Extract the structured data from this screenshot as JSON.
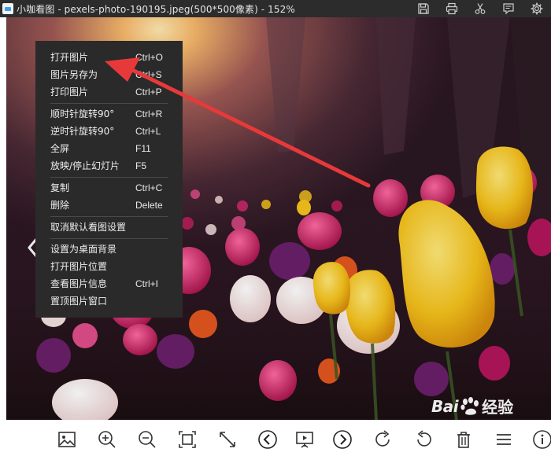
{
  "window": {
    "title": "小咖看图 - pexels-photo-190195.jpeg(500*500像素) - 152%"
  },
  "title_actions": [
    {
      "icon": "save-icon"
    },
    {
      "icon": "print-icon"
    },
    {
      "icon": "scissors-icon"
    },
    {
      "icon": "comment-icon"
    },
    {
      "icon": "gear-icon"
    }
  ],
  "context_menu": {
    "groups": [
      [
        {
          "label": "打开图片",
          "shortcut": "Ctrl+O"
        },
        {
          "label": "图片另存为",
          "shortcut": "Ctrl+S"
        },
        {
          "label": "打印图片",
          "shortcut": "Ctrl+P"
        }
      ],
      [
        {
          "label": "顺时针旋转90°",
          "shortcut": "Ctrl+R"
        },
        {
          "label": "逆时针旋转90°",
          "shortcut": "Ctrl+L"
        },
        {
          "label": "全屏",
          "shortcut": "F11"
        },
        {
          "label": "放映/停止幻灯片",
          "shortcut": "F5"
        }
      ],
      [
        {
          "label": "复制",
          "shortcut": "Ctrl+C"
        },
        {
          "label": "删除",
          "shortcut": "Delete"
        }
      ],
      [
        {
          "label": "取消默认看图设置",
          "shortcut": ""
        }
      ],
      [
        {
          "label": "设置为桌面背景",
          "shortcut": ""
        },
        {
          "label": "打开图片位置",
          "shortcut": ""
        },
        {
          "label": "查看图片信息",
          "shortcut": "Ctrl+I"
        },
        {
          "label": "置顶图片窗口",
          "shortcut": ""
        }
      ]
    ]
  },
  "toolbar": {
    "buttons": [
      {
        "icon": "picture-icon"
      },
      {
        "icon": "zoom-in-icon"
      },
      {
        "icon": "zoom-out-icon"
      },
      {
        "icon": "actual-size-icon"
      },
      {
        "icon": "fit-screen-icon"
      },
      {
        "icon": "previous-icon"
      },
      {
        "icon": "slideshow-icon"
      },
      {
        "icon": "next-icon"
      },
      {
        "icon": "rotate-clockwise-icon"
      },
      {
        "icon": "rotate-counterclockwise-icon"
      },
      {
        "icon": "delete-icon"
      },
      {
        "icon": "menu-icon"
      },
      {
        "icon": "info-icon"
      }
    ]
  },
  "watermark": {
    "brand_latin": "Bai",
    "brand_cn": "经验"
  },
  "colors": {
    "titlebar_bg": "#2c2c2c",
    "menu_bg": "#2a2a2a",
    "annotation_arrow": "#e8393a",
    "tulip_yellow": "#f5c21c",
    "tulip_magenta": "#d6296f"
  }
}
